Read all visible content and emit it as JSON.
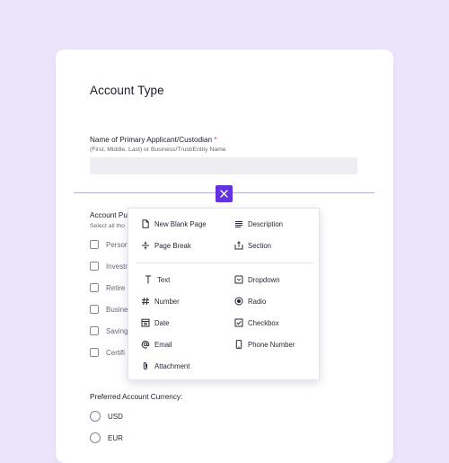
{
  "form": {
    "title": "Account Type",
    "name_question": {
      "label": "Name of Primary Applicant/Custodian",
      "required_mark": "*",
      "help": "(First, Middle, Last) or Business/Trust/Entity Name",
      "value": ""
    },
    "purpose_question": {
      "label": "Account Pu",
      "help": "Select all tho",
      "options": [
        "Person",
        "Investr",
        "Retire",
        "Busine",
        "Saving",
        "Certifi"
      ]
    },
    "currency_question": {
      "label": "Preferred Account Currency:",
      "options": [
        "USD",
        "EUR"
      ]
    }
  },
  "add_menu": {
    "page_items": [
      {
        "label": "New Blank Page",
        "icon": "page-icon"
      },
      {
        "label": "Description",
        "icon": "lines-icon"
      },
      {
        "label": "Page Break",
        "icon": "page-break-icon"
      },
      {
        "label": "Section",
        "icon": "section-icon"
      }
    ],
    "field_items": [
      {
        "label": "Text",
        "icon": "text-icon"
      },
      {
        "label": "Dropdown",
        "icon": "dropdown-icon"
      },
      {
        "label": "Number",
        "icon": "hash-icon"
      },
      {
        "label": "Radio",
        "icon": "radio-icon"
      },
      {
        "label": "Date",
        "icon": "calendar-icon"
      },
      {
        "label": "Checkbox",
        "icon": "checkbox-icon"
      },
      {
        "label": "Email",
        "icon": "at-icon"
      },
      {
        "label": "Phone Number",
        "icon": "phone-icon"
      },
      {
        "label": "Attachment",
        "icon": "paperclip-icon"
      }
    ]
  },
  "colors": {
    "background": "#ebe4fb",
    "accent": "#6332e0",
    "required": "#d0344a"
  }
}
